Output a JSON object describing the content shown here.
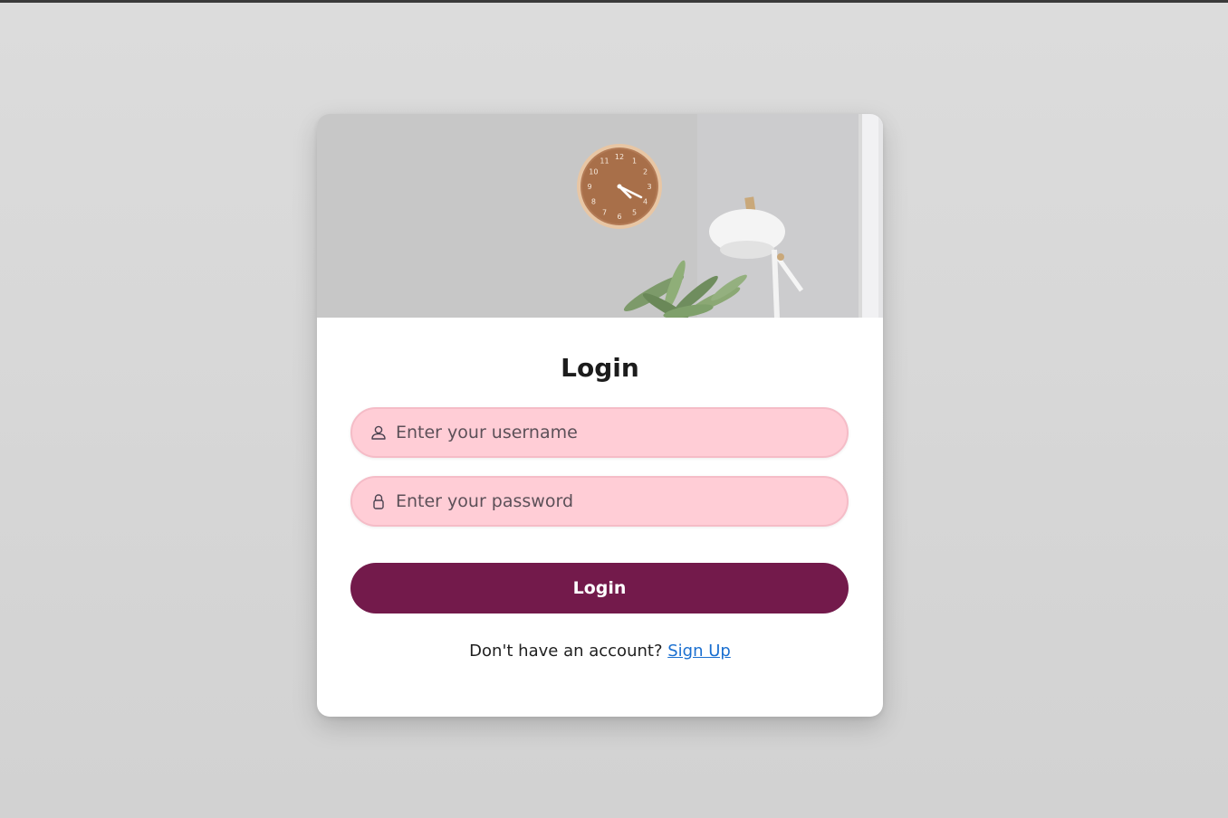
{
  "form": {
    "title": "Login",
    "username_placeholder": "Enter your username",
    "password_placeholder": "Enter your password",
    "submit_label": "Login",
    "signup_prompt": "Don't have an account? ",
    "signup_link": "Sign Up"
  },
  "hero": {
    "clock_numerals": [
      "12",
      "1",
      "2",
      "3",
      "4",
      "5",
      "6",
      "7",
      "8",
      "9",
      "10",
      "11"
    ]
  },
  "icons": {
    "username": "user-icon",
    "password": "lock-icon"
  },
  "colors": {
    "page_background": "#d8d8d8",
    "card": "#ffffff",
    "input_background": "#ffcdd6",
    "button": "#731a4b",
    "link": "#1a6fd0"
  }
}
